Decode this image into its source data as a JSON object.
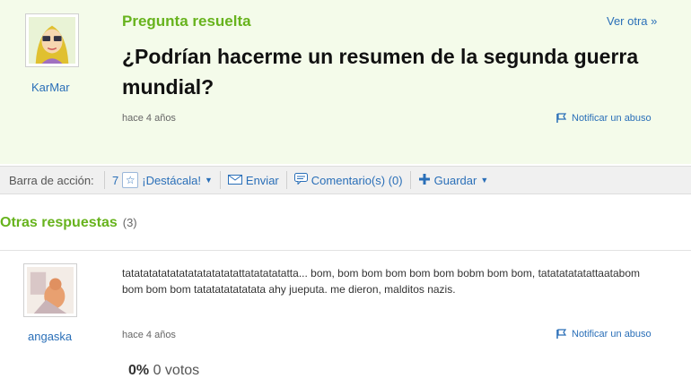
{
  "question": {
    "status_label": "Pregunta resuelta",
    "see_other_label": "Ver otra »",
    "title": "¿Podrían hacerme un resumen de la segunda guerra mundial?",
    "asker": "KarMar",
    "time_ago": "hace 4 años",
    "report_label": "Notificar un abuso"
  },
  "action_bar": {
    "label": "Barra de acción:",
    "star_count": "7",
    "highlight_label": "¡Destácala!",
    "send_label": "Enviar",
    "comments_label": "Comentario(s) (0)",
    "save_label": "Guardar"
  },
  "other_answers": {
    "heading": "Otras respuestas",
    "count": "(3)",
    "items": [
      {
        "user": "angaska",
        "text": "tatatatatatatatatatatatatattatatatatatta... bom, bom bom bom bom bom bobm bom bom, tatatatatatattaatabom bom bom bom tatatatatatatata ahy jueputa. me dieron, malditos nazis.",
        "time_ago": "hace 4 años",
        "report_label": "Notificar un abuso",
        "votes_percent": "0%",
        "votes_label": "0 votos"
      }
    ]
  },
  "colors": {
    "status_green": "#67b31d",
    "link_blue": "#2a6fb8",
    "panel_bg": "#f4fbea"
  }
}
